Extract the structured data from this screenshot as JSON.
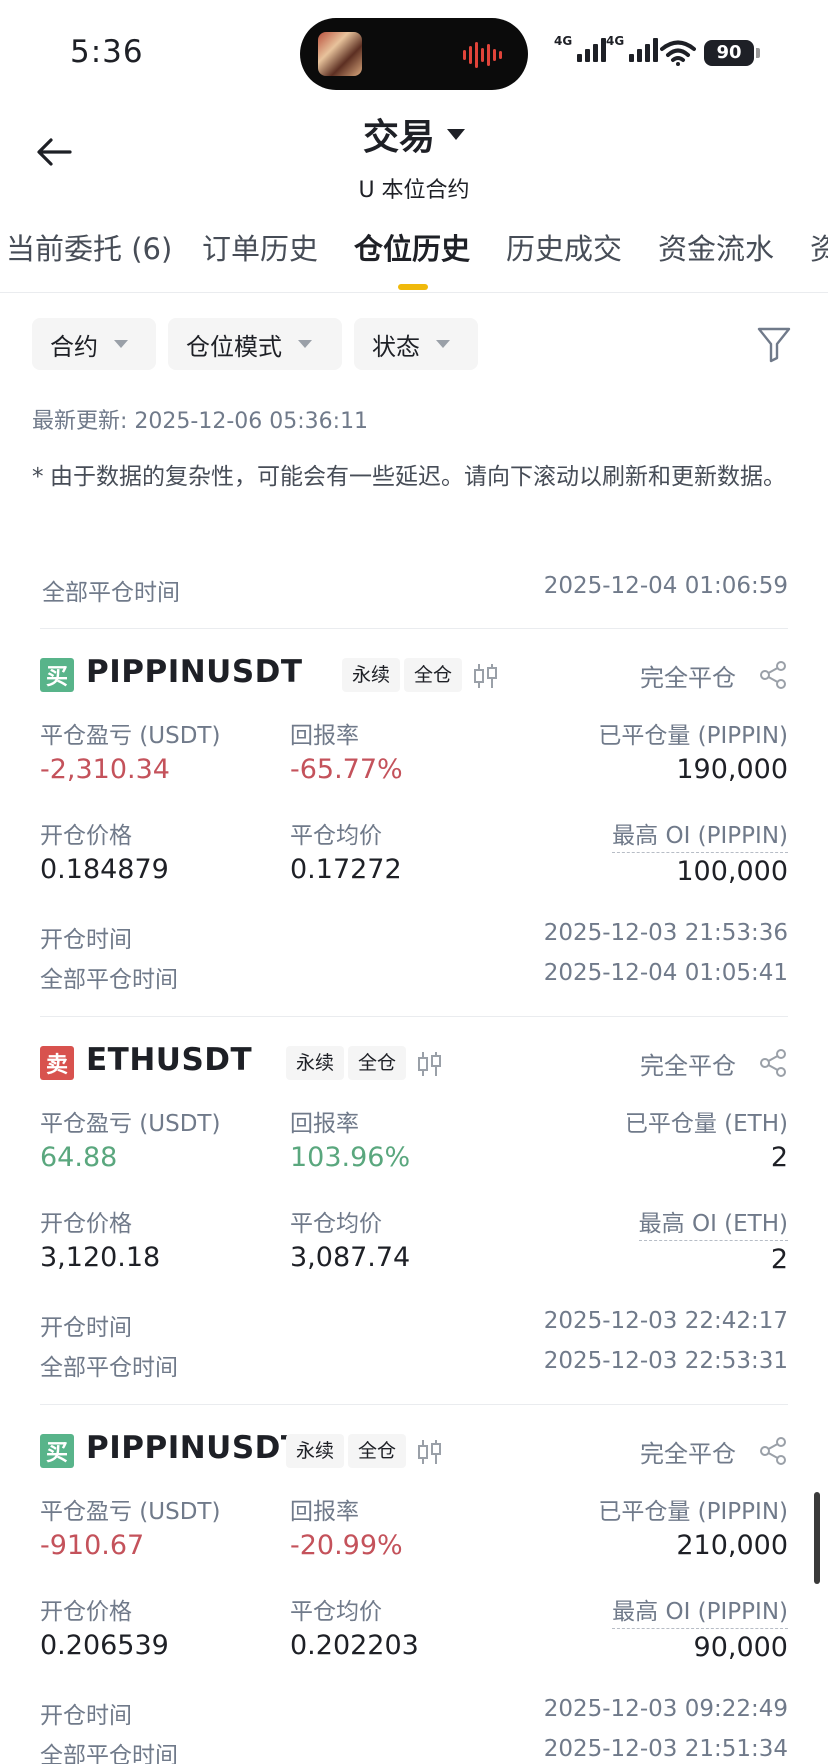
{
  "status_bar": {
    "time": "5:36",
    "network1": "4G",
    "network2": "4G",
    "battery": "90"
  },
  "header": {
    "title": "交易",
    "subtitle": "U 本位合约"
  },
  "tabs": [
    {
      "label": "当前委托 (6)"
    },
    {
      "label": "订单历史"
    },
    {
      "label": "仓位历史"
    },
    {
      "label": "历史成交"
    },
    {
      "label": "资金流水"
    },
    {
      "label": "资"
    }
  ],
  "active_tab": "仓位历史",
  "filters": {
    "contract": "合约",
    "position_mode": "仓位模式",
    "status": "状态"
  },
  "last_updated": "最新更新: 2025-12-06 05:36:11",
  "notice": "由于数据的复杂性，可能会有一些延迟。请向下滚动以刷新和更新数据。",
  "notice_star": "*",
  "partial_record": {
    "close_time_label": "全部平仓时间",
    "close_time": "2025-12-04 01:06:59"
  },
  "records": [
    {
      "side": "买",
      "side_type": "buy",
      "symbol": "PIPPINUSDT",
      "tag1": "永续",
      "tag2": "全仓",
      "status": "完全平仓",
      "pnl_label": "平仓盈亏 (USDT)",
      "pnl": "-2,310.34",
      "pnl_sign": "neg",
      "roi_label": "回报率",
      "roi": "-65.77%",
      "closed_qty_label": "已平仓量 (PIPPIN)",
      "closed_qty": "190,000",
      "open_price_label": "开仓价格",
      "open_price": "0.184879",
      "avg_close_label": "平仓均价",
      "avg_close": "0.17272",
      "max_oi_label": "最高 OI (PIPPIN)",
      "max_oi": "100,000",
      "open_time_label": "开仓时间",
      "open_time": "2025-12-03 21:53:36",
      "close_time_label": "全部平仓时间",
      "close_time": "2025-12-04 01:05:41"
    },
    {
      "side": "卖",
      "side_type": "sell",
      "symbol": "ETHUSDT",
      "tag1": "永续",
      "tag2": "全仓",
      "status": "完全平仓",
      "pnl_label": "平仓盈亏 (USDT)",
      "pnl": "64.88",
      "pnl_sign": "pos",
      "roi_label": "回报率",
      "roi": "103.96%",
      "closed_qty_label": "已平仓量 (ETH)",
      "closed_qty": "2",
      "open_price_label": "开仓价格",
      "open_price": "3,120.18",
      "avg_close_label": "平仓均价",
      "avg_close": "3,087.74",
      "max_oi_label": "最高 OI (ETH)",
      "max_oi": "2",
      "open_time_label": "开仓时间",
      "open_time": "2025-12-03 22:42:17",
      "close_time_label": "全部平仓时间",
      "close_time": "2025-12-03 22:53:31"
    },
    {
      "side": "买",
      "side_type": "buy",
      "symbol": "PIPPINUSDT",
      "tag1": "永续",
      "tag2": "全仓",
      "status": "完全平仓",
      "pnl_label": "平仓盈亏 (USDT)",
      "pnl": "-910.67",
      "pnl_sign": "neg",
      "roi_label": "回报率",
      "roi": "-20.99%",
      "closed_qty_label": "已平仓量 (PIPPIN)",
      "closed_qty": "210,000",
      "open_price_label": "开仓价格",
      "open_price": "0.206539",
      "avg_close_label": "平仓均价",
      "avg_close": "0.202203",
      "max_oi_label": "最高 OI (PIPPIN)",
      "max_oi": "90,000",
      "open_time_label": "开仓时间",
      "open_time": "2025-12-03 09:22:49",
      "close_time_label": "全部平仓时间",
      "close_time": "2025-12-03 21:51:34"
    }
  ],
  "colors": {
    "accent": "#f0b90b",
    "profit": "#5aa77e",
    "loss": "#c4525b",
    "buy": "#58b48a",
    "sell": "#d8524e"
  }
}
